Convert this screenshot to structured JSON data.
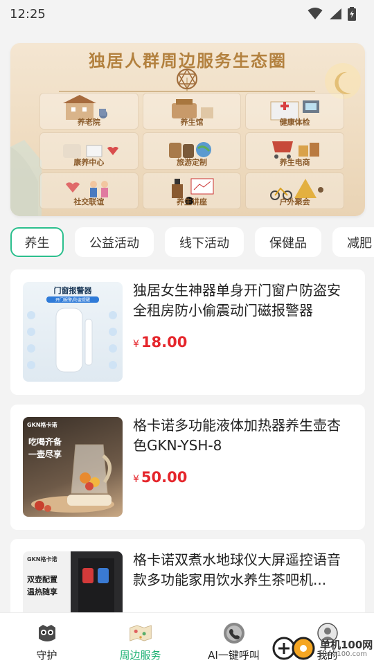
{
  "status_bar": {
    "time": "12:25"
  },
  "banner": {
    "title": "独居人群周边服务生态圈",
    "cells": [
      {
        "label": "养老院"
      },
      {
        "label": "养生馆"
      },
      {
        "label": "健康体检"
      },
      {
        "label": "康养中心"
      },
      {
        "label": "旅游定制"
      },
      {
        "label": "养生电商"
      },
      {
        "label": "社交联谊"
      },
      {
        "label": "养生讲座"
      },
      {
        "label": "户外聚会"
      }
    ]
  },
  "tabs": [
    {
      "label": "养生",
      "active": true
    },
    {
      "label": "公益活动",
      "active": false
    },
    {
      "label": "线下活动",
      "active": false
    },
    {
      "label": "保健品",
      "active": false
    },
    {
      "label": "减肥",
      "active": false
    }
  ],
  "products": [
    {
      "title": "独居女生神器单身开门窗户防盗安全租房防小偷震动门磁报警器",
      "currency": "¥",
      "price": "18.00",
      "image_text": {
        "heading": "门窗报警器",
        "sub": "开门报警/防盗提醒"
      }
    },
    {
      "title": "格卡诺多功能液体加热器养生壶杏色GKN-YSH-8",
      "currency": "¥",
      "price": "50.00",
      "image_text": {
        "brand": "GKN格卡诺",
        "line1": "吃喝齐备",
        "line2": "一壶尽享"
      }
    },
    {
      "title": "格卡诺双煮水地球仪大屏遥控语音款多功能家用饮水养生茶吧机...",
      "currency": "¥",
      "price": "",
      "image_text": {
        "brand": "GKN格卡诺",
        "line1": "双壶配置",
        "line2": "温热随享"
      }
    }
  ],
  "bottom_nav": [
    {
      "label": "守护",
      "icon": "owl-icon",
      "active": false
    },
    {
      "label": "周边服务",
      "icon": "map-icon",
      "active": true
    },
    {
      "label": "AI一键呼叫",
      "icon": "call-icon",
      "active": false
    },
    {
      "label": "我的",
      "icon": "profile-icon",
      "active": false
    }
  ],
  "watermark": {
    "text": "单机100网",
    "url": "danji100.com"
  },
  "colors": {
    "accent": "#19b071",
    "tab_border": "#2bbf8d",
    "price": "#e5262c",
    "banner_title": "#b3813f"
  }
}
